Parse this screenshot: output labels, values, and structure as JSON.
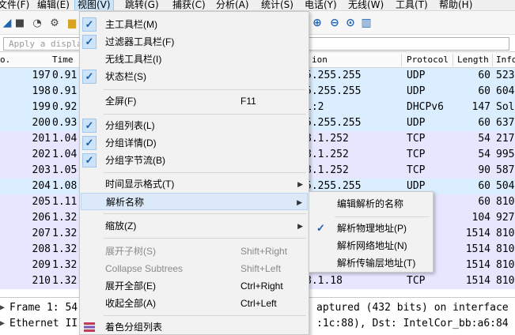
{
  "menubar": {
    "items": [
      "文件(F)",
      "编辑(E)",
      "视图(V)",
      "跳转(G)",
      "捕获(C)",
      "分析(A)",
      "统计(S)",
      "电话(Y)",
      "无线(W)",
      "工具(T)",
      "帮助(H)"
    ],
    "active_index": 2
  },
  "filter": {
    "placeholder": "Apply a display filter ... <Ctrl-/>",
    "visible_text": "Apply a displa"
  },
  "packet_list": {
    "columns": [
      "o.",
      "Time",
      "ion",
      "Protocol",
      "Length",
      "Info"
    ],
    "rows": [
      {
        "no": "197",
        "time": "0.91",
        "dst": "5.255.255",
        "proto": "UDP",
        "len": "60",
        "info": "523",
        "color": "#daeeff"
      },
      {
        "no": "198",
        "time": "0.91",
        "dst": "5.255.255",
        "proto": "UDP",
        "len": "60",
        "info": "604",
        "color": "#daeeff"
      },
      {
        "no": "199",
        "time": "0.92",
        "dst": "1:2",
        "proto": "DHCPv6",
        "len": "147",
        "info": "Sol",
        "color": "#daeeff"
      },
      {
        "no": "200",
        "time": "0.93",
        "dst": "5.255.255",
        "proto": "UDP",
        "len": "60",
        "info": "637",
        "color": "#daeeff"
      },
      {
        "no": "201",
        "time": "1.04",
        "dst": "8.1.252",
        "proto": "TCP",
        "len": "54",
        "info": "217",
        "color": "#e7e6ff"
      },
      {
        "no": "202",
        "time": "1.04",
        "dst": "8.1.252",
        "proto": "TCP",
        "len": "54",
        "info": "995",
        "color": "#e7e6ff"
      },
      {
        "no": "203",
        "time": "1.05",
        "dst": "8.1.252",
        "proto": "TCP",
        "len": "90",
        "info": "587",
        "color": "#e7e6ff"
      },
      {
        "no": "204",
        "time": "1.08",
        "dst": "5.255.255",
        "proto": "UDP",
        "len": "60",
        "info": "504",
        "color": "#daeeff"
      },
      {
        "no": "205",
        "time": "1.11",
        "dst": "",
        "proto": "",
        "len": "60",
        "info": "810",
        "color": "#e7e6ff"
      },
      {
        "no": "206",
        "time": "1.32",
        "dst": "",
        "proto": "",
        "len": "104",
        "info": "927",
        "color": "#e7e6ff"
      },
      {
        "no": "207",
        "time": "1.32",
        "dst": "",
        "proto": "",
        "len": "1514",
        "info": "810",
        "color": "#e7e6ff"
      },
      {
        "no": "208",
        "time": "1.32",
        "dst": "",
        "proto": "",
        "len": "1514",
        "info": "810",
        "color": "#e7e6ff"
      },
      {
        "no": "209",
        "time": "1.32",
        "dst": "",
        "proto": "",
        "len": "1514",
        "info": "810",
        "color": "#e7e6ff"
      },
      {
        "no": "210",
        "time": "1.32",
        "dst": "8.1.18",
        "proto": "TCP",
        "len": "1514",
        "info": "810",
        "color": "#e7e6ff"
      }
    ]
  },
  "details": {
    "line1_left": "Frame 1: 54",
    "line1_right": "aptured (432 bits) on interface",
    "line2_left": "Ethernet II",
    "line2_right": ":1c:88), Dst: IntelCor_bb:a6:84"
  },
  "view_menu": {
    "items": [
      {
        "label": "主工具栏(M)",
        "checked": true
      },
      {
        "label": "过滤器工具栏(F)",
        "checked": true
      },
      {
        "label": "无线工具栏(I)",
        "checked": false
      },
      {
        "label": "状态栏(S)",
        "checked": true
      },
      {
        "label": "全屏(F)",
        "shortcut": "F11"
      },
      {
        "label": "分组列表(L)",
        "checked": true
      },
      {
        "label": "分组详情(D)",
        "checked": true
      },
      {
        "label": "分组字节流(B)",
        "checked": true
      },
      {
        "label": "时间显示格式(T)",
        "submenu": true
      },
      {
        "label": "解析名称",
        "submenu": true
      },
      {
        "label": "缩放(Z)",
        "submenu": true
      },
      {
        "label": "展开子树(S)",
        "shortcut": "Shift+Right",
        "disabled": true
      },
      {
        "label": "Collapse Subtrees",
        "shortcut": "Shift+Left",
        "disabled": true
      },
      {
        "label": "展开全部(E)",
        "shortcut": "Ctrl+Right"
      },
      {
        "label": "收起全部(A)",
        "shortcut": "Ctrl+Left"
      },
      {
        "label": "着色分组列表"
      }
    ]
  },
  "resolve_submenu": {
    "items": [
      {
        "label": "编辑解析的名称",
        "checked": false
      },
      {
        "label": "解析物理地址(P)",
        "checked": true
      },
      {
        "label": "解析网络地址(N)",
        "checked": false
      },
      {
        "label": "解析传输层地址(T)",
        "checked": false
      }
    ]
  },
  "icons": {
    "check": "✓",
    "submenu_arrow": "▶",
    "expand_arrow": "▶"
  }
}
